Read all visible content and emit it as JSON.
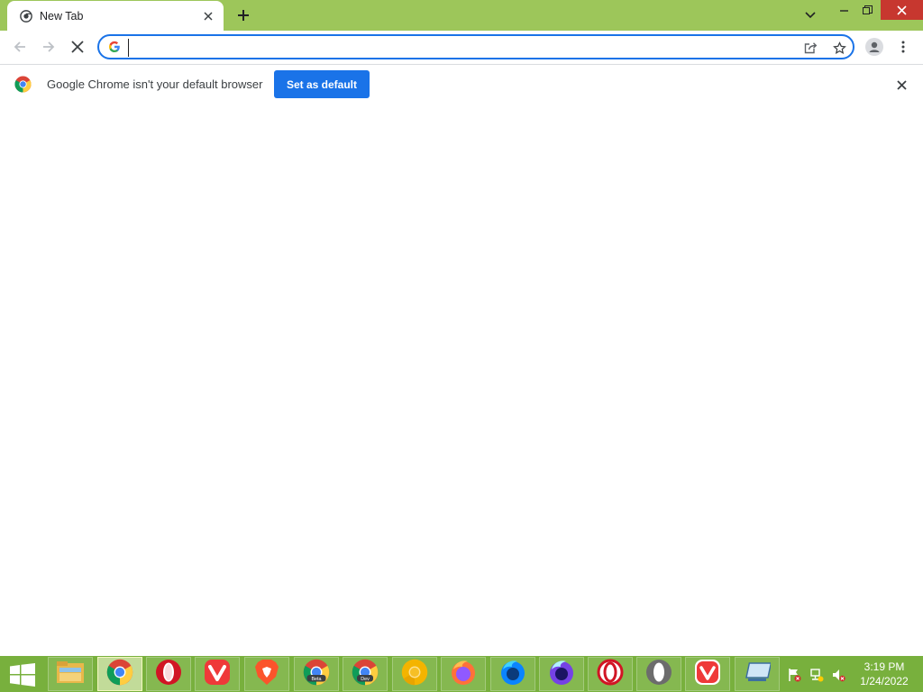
{
  "window": {
    "tab": {
      "title": "New Tab"
    },
    "title_bar_color": "#9dc65a"
  },
  "toolbar": {
    "omnibox": {
      "value": "",
      "placeholder": ""
    }
  },
  "infobar": {
    "message": "Google Chrome isn't your default browser",
    "button_label": "Set as default"
  },
  "taskbar": {
    "apps": [
      {
        "name": "File Explorer",
        "icon": "folder-icon"
      },
      {
        "name": "Google Chrome",
        "icon": "chrome-icon",
        "active": true
      },
      {
        "name": "Opera",
        "icon": "opera-icon"
      },
      {
        "name": "Vivaldi",
        "icon": "vivaldi-icon"
      },
      {
        "name": "Brave",
        "icon": "brave-icon"
      },
      {
        "name": "Chrome Beta",
        "icon": "chrome-beta-icon",
        "badge": "Beta"
      },
      {
        "name": "Chrome Dev",
        "icon": "chrome-dev-icon",
        "badge": "Dev"
      },
      {
        "name": "Chrome Canary",
        "icon": "chrome-canary-icon"
      },
      {
        "name": "Firefox",
        "icon": "firefox-icon"
      },
      {
        "name": "Firefox Developer Edition",
        "icon": "firefox-dev-icon"
      },
      {
        "name": "Firefox Nightly",
        "icon": "firefox-nightly-icon"
      },
      {
        "name": "Opera GX",
        "icon": "opera-gx-icon"
      },
      {
        "name": "Opera Developer",
        "icon": "opera-dev-icon"
      },
      {
        "name": "Vivaldi Snapshot",
        "icon": "vivaldi-snapshot-icon"
      },
      {
        "name": "Remote Desktop",
        "icon": "remote-desktop-icon"
      }
    ],
    "clock": {
      "time": "3:19 PM",
      "date": "1/24/2022"
    },
    "color": "#78b03d"
  },
  "colors": {
    "accent": "#1a73e8",
    "close_button": "#c7372f"
  }
}
